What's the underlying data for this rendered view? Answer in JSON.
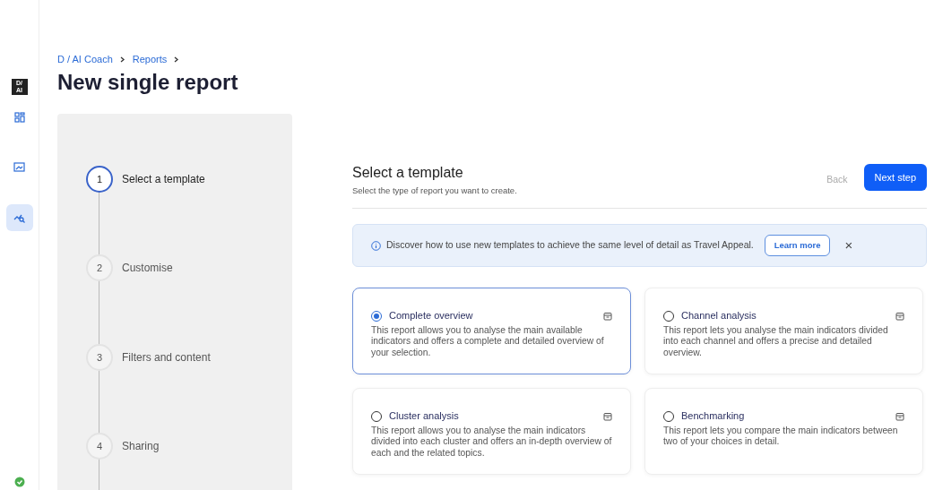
{
  "rail": {
    "logo": "D/\nAI",
    "items": [
      {
        "kind": "grid",
        "selected": false
      },
      {
        "kind": "image",
        "selected": false
      },
      {
        "kind": "analytics",
        "selected": true
      }
    ],
    "status": {
      "kind": "check"
    }
  },
  "breadcrumb": [
    "D / AI Coach",
    "Reports"
  ],
  "title": "New single report",
  "steps": [
    {
      "number": "1",
      "label": "Select a template",
      "active": true
    },
    {
      "number": "2",
      "label": "Customise",
      "active": false
    },
    {
      "number": "3",
      "label": "Filters and content",
      "active": false
    },
    {
      "number": "4",
      "label": "Sharing",
      "active": false
    }
  ],
  "panel": {
    "heading": "Select a template",
    "subtitle": "Select the type of report you want to create.",
    "back_button": {
      "label": "Back",
      "disabled": true
    },
    "next_button": "Next step"
  },
  "alert": {
    "text": "Discover how to use new templates to achieve the same level of detail as Travel Appeal.",
    "button": "Learn more",
    "close": "×"
  },
  "templates": [
    {
      "title": "Complete overview",
      "description": "This report allows you to analyse the main available indicators and offers a complete and detailed overview of your selection.",
      "selected": true
    },
    {
      "title": "Channel analysis",
      "description": "This report lets you analyse the main indicators divided into each channel and offers a precise and detailed overview.",
      "selected": false
    },
    {
      "title": "Cluster analysis",
      "description": "This report allows you to analyse the main indicators divided into each cluster and offers an in-depth overview of each and the related topics.",
      "selected": false
    },
    {
      "title": "Benchmarking",
      "description": "This report lets you compare the main indicators between two of your choices in detail.",
      "selected": false
    }
  ]
}
